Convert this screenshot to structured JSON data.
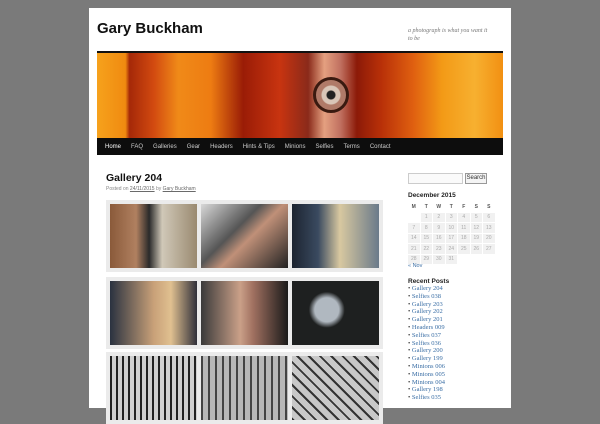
{
  "site": {
    "title": "Gary Buckham",
    "tagline": "a photograph is what you want it to be"
  },
  "nav": [
    "Home",
    "FAQ",
    "Galleries",
    "Gear",
    "Headers",
    "Hints & Tips",
    "Minions",
    "Selfies",
    "Terms",
    "Contact"
  ],
  "post": {
    "title": "Gallery 204",
    "posted_on": "Posted on",
    "date": "24/11/2015",
    "by": "by",
    "author": "Gary Buckham"
  },
  "sidebar": {
    "search_button": "Search",
    "calendar": {
      "title": "December 2015",
      "days": [
        "M",
        "T",
        "W",
        "T",
        "F",
        "S",
        "S"
      ],
      "weeks": [
        [
          "",
          "1",
          "2",
          "3",
          "4",
          "5",
          "6"
        ],
        [
          "7",
          "8",
          "9",
          "10",
          "11",
          "12",
          "13"
        ],
        [
          "14",
          "15",
          "16",
          "17",
          "18",
          "19",
          "20"
        ],
        [
          "21",
          "22",
          "23",
          "24",
          "25",
          "26",
          "27"
        ],
        [
          "28",
          "29",
          "30",
          "31",
          "",
          "",
          ""
        ]
      ],
      "prev": "« Nov"
    },
    "recent_title": "Recent Posts",
    "recent": [
      "Gallery 204",
      "Selfies 038",
      "Gallery 203",
      "Gallery 202",
      "Gallery 201",
      "Headers 009",
      "Selfies 037",
      "Selfies 036",
      "Gallery 200",
      "Gallery 199",
      "Minions 006",
      "Minions 005",
      "Minions 004",
      "Gallery 198",
      "Selfies 035"
    ]
  }
}
